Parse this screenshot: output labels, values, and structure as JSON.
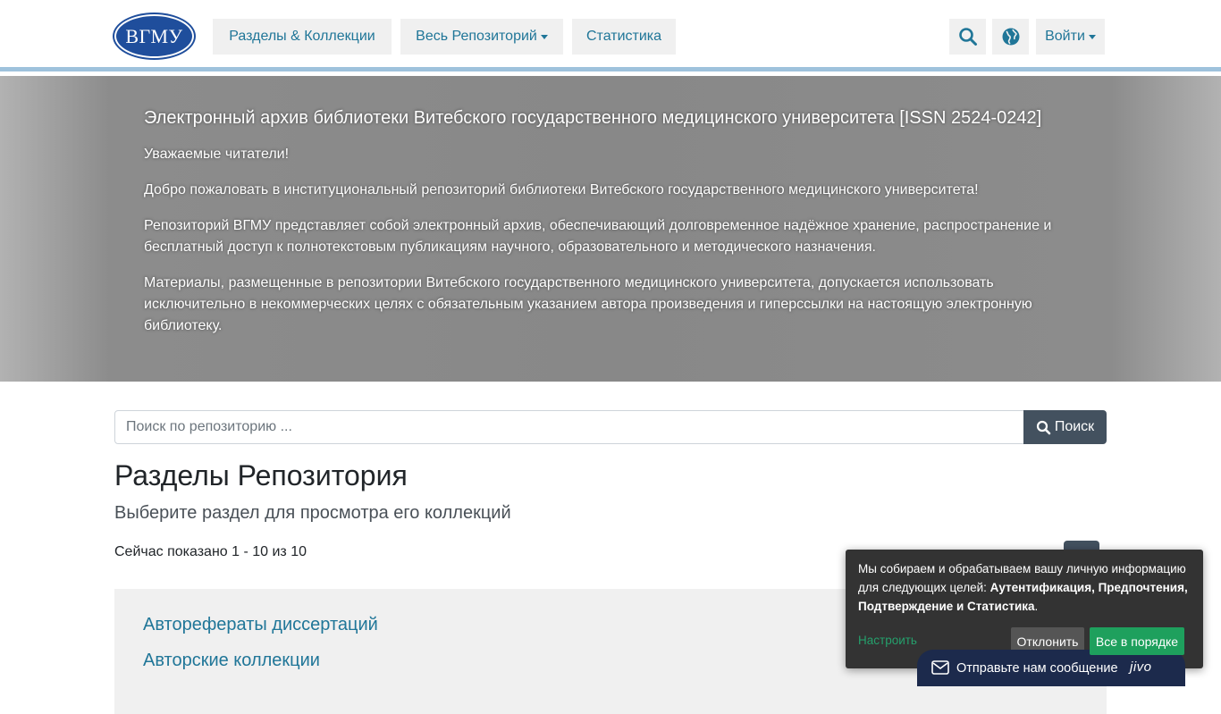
{
  "header": {
    "logo_text": "ВГМУ",
    "nav": [
      {
        "label": "Разделы & Коллекции"
      },
      {
        "label": "Весь Репозиторий"
      },
      {
        "label": "Статистика"
      }
    ],
    "login_label": "Войти"
  },
  "banner": {
    "title": "Электронный архив библиотеки Витебского государственного медицинского университета [ISSN 2524-0242]",
    "paragraphs": [
      "Уважаемые читатели!",
      "Добро пожаловать в институциональный репозиторий библиотеки Витебского государственного медицинского университета!",
      "Репозиторий ВГМУ представляет собой электронный архив, обеспечивающий долговременное надёжное хранение, распространение и бесплатный доступ к полнотекстовым публикациям научного, образовательного и методического назначения.",
      "Материалы, размещенные в репозитории Витебского государственного медицинского университета, допускается использовать исключительно в некоммерческих целях с обязательным указанием автора произведения и гиперссылки на настоящую электронную библиотеку."
    ]
  },
  "search": {
    "placeholder": "Поиск по репозиторию ...",
    "button_label": "Поиск"
  },
  "main": {
    "title": "Разделы Репозитория",
    "subtitle": "Выберите раздел для просмотра его коллекций",
    "showing": "Сейчас показано 1 - 10 из 10",
    "items": [
      {
        "label": "Авторефераты диссертаций"
      },
      {
        "label": "Авторские коллекции"
      }
    ]
  },
  "cookie": {
    "text_plain": "Мы собираем и обрабатываем вашу личную информацию для следующих целей: ",
    "text_bold": "Аутентификация, Предпочтения, Подтверждение и Статистика",
    "text_end": ".",
    "configure_label": "Настроить",
    "decline_label": "Отклонить",
    "accept_label": "Все в порядке"
  },
  "jivo": {
    "message_label": "Отправьте нам сообщение",
    "brand": "jivo"
  },
  "colors": {
    "link": "#207698",
    "dark_button": "#43515f",
    "accept": "#1ea05d"
  }
}
